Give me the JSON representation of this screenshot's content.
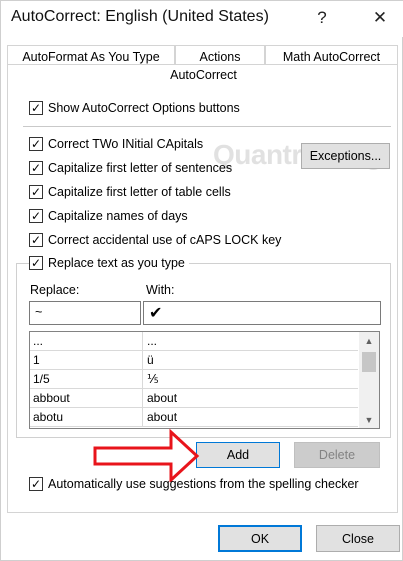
{
  "window": {
    "title": "AutoCorrect: English (United States)",
    "help_glyph": "?",
    "close_glyph": "✕"
  },
  "tabs": [
    {
      "label": "AutoFormat As You Type"
    },
    {
      "label": "Actions"
    },
    {
      "label": "Math AutoCorrect"
    }
  ],
  "active_tab": {
    "label": "AutoCorrect"
  },
  "options": {
    "show_buttons": {
      "label": "Show AutoCorrect Options buttons",
      "checked": true
    },
    "two_initial": {
      "label": "Correct TWo INitial CApitals",
      "checked": true
    },
    "first_sentence": {
      "label": "Capitalize first letter of sentences",
      "checked": true
    },
    "first_table": {
      "label": "Capitalize first letter of table cells",
      "checked": true
    },
    "names_days": {
      "label": "Capitalize names of days",
      "checked": true
    },
    "caps_lock": {
      "label": "Correct accidental use of cAPS LOCK key",
      "checked": true
    },
    "replace_text": {
      "label": "Replace text as you type",
      "checked": true
    },
    "spelling": {
      "label": "Automatically use suggestions from the spelling checker",
      "checked": true
    }
  },
  "check_glyph": "✓",
  "exceptions_button": "Exceptions...",
  "replace": {
    "replace_label": "Replace:",
    "with_label": "With:",
    "replace_value": "~",
    "with_value": "✔"
  },
  "list": [
    {
      "replace": "...",
      "with": "..."
    },
    {
      "replace": "1",
      "with": "ü"
    },
    {
      "replace": "1/5",
      "with": "⅕"
    },
    {
      "replace": "abbout",
      "with": "about"
    },
    {
      "replace": "abotu",
      "with": "about"
    }
  ],
  "scroll_up": "▲",
  "scroll_down": "▼",
  "buttons": {
    "add": "Add",
    "delete": "Delete",
    "ok": "OK",
    "close": "Close"
  },
  "watermark": "Quantrimang",
  "colors": {
    "arrow": "#e8141b",
    "primary_border": "#0078d7"
  }
}
